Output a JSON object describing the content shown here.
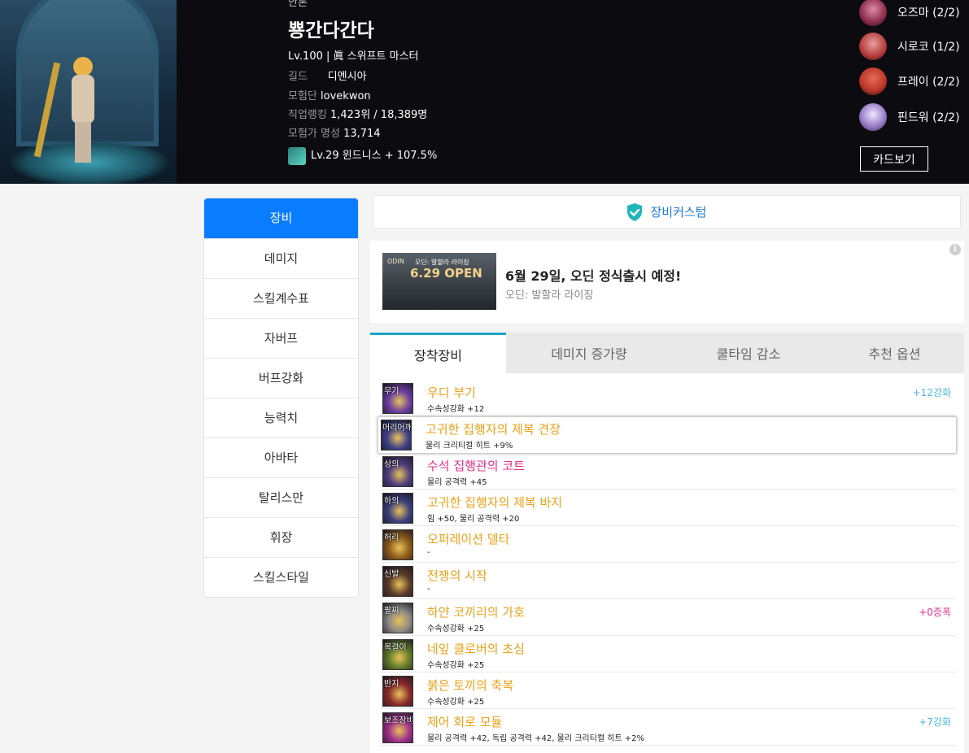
{
  "header": {
    "server": "안톤",
    "character_name": "뿅간다간다",
    "level_class": "Lv.100 | 眞 스위프트 마스터",
    "guild_label": "길드",
    "guild_value": "디멘시아",
    "adventure_label": "모험단",
    "adventure_value": "lovekwon",
    "job_rank_label": "직업랭킹",
    "job_rank_value": "1,423위 / 18,389명",
    "fame_label": "모험가 명성",
    "fame_value": "13,714",
    "gem_text": "Lv.29 윈드니스 + 107.5%"
  },
  "cards": {
    "items": [
      {
        "name": "오즈마 (2/2)",
        "color": "#8a2b4a"
      },
      {
        "name": "시로코 (1/2)",
        "color": "#b33a3a"
      },
      {
        "name": "프레이 (2/2)",
        "color": "#c0392b"
      },
      {
        "name": "핀드워 (2/2)",
        "color": "#9a7fc8"
      }
    ],
    "button_label": "카드보기"
  },
  "sidebar": {
    "items": [
      {
        "label": "장비",
        "active": true
      },
      {
        "label": "데미지"
      },
      {
        "label": "스킬계수표"
      },
      {
        "label": "자버프"
      },
      {
        "label": "버프강화"
      },
      {
        "label": "능력치"
      },
      {
        "label": "아바타"
      },
      {
        "label": "탈리스만"
      },
      {
        "label": "휘장"
      },
      {
        "label": "스킬스타일"
      }
    ]
  },
  "custom_button": {
    "label": "장비커스텀",
    "icon": "shield-check-icon",
    "color": "#1fb6b8"
  },
  "banner": {
    "thumb_brand": "ODIN",
    "thumb_sub": "오딘: 발할라 라이징",
    "thumb_open": "6.29 OPEN",
    "title": "6월 29일, 오딘 정식출시 예정!",
    "subtitle": "오딘: 발할라 라이징",
    "info_icon": "i"
  },
  "tabs": [
    {
      "label": "장착장비",
      "active": true
    },
    {
      "label": "데미지 증가량"
    },
    {
      "label": "쿨타임 감소"
    },
    {
      "label": "추천 옵션"
    }
  ],
  "equipment": [
    {
      "slot": "무기",
      "name": "우디 부기",
      "stat": "수속성강화 +12",
      "right": "+12강화",
      "right_color": "#4ab6e0",
      "name_color": "orange",
      "icon_color": "#6b3fa0"
    },
    {
      "slot": "머리어깨",
      "name": "고귀한 집행자의 제복 견장",
      "stat": "물리 크리티컬 히트 +9%",
      "right": "",
      "name_color": "orange",
      "icon_color": "#3c3f86",
      "selected": true
    },
    {
      "slot": "상의",
      "name": "수석 집행관의 코트",
      "stat": "물리 공격력 +45",
      "right": "",
      "name_color": "pink",
      "icon_color": "#4e3e7e"
    },
    {
      "slot": "하의",
      "name": "고귀한 집행자의 제복 바지",
      "stat": "힘 +50, 물리 공격력 +20",
      "right": "",
      "name_color": "orange",
      "icon_color": "#3b3f7d"
    },
    {
      "slot": "허리",
      "name": "오퍼레이션 델타",
      "stat": "-",
      "right": "",
      "name_color": "orange",
      "icon_color": "#8a5a1a"
    },
    {
      "slot": "신발",
      "name": "전쟁의 시작",
      "stat": "-",
      "right": "",
      "name_color": "orange",
      "icon_color": "#5a3b2a"
    },
    {
      "slot": "팔찌",
      "name": "하얀 코끼리의 가호",
      "stat": "수속성강화 +25",
      "right": "+0증폭",
      "right_color": "#e0308a",
      "name_color": "orange",
      "icon_color": "#8d8a86"
    },
    {
      "slot": "목걸이",
      "name": "네잎 클로버의 초심",
      "stat": "수속성강화 +25",
      "right": "",
      "name_color": "orange",
      "icon_color": "#5e7a2a"
    },
    {
      "slot": "반지",
      "name": "붉은 토끼의 축복",
      "stat": "수속성강화 +25",
      "right": "",
      "name_color": "orange",
      "icon_color": "#8a2a2a"
    },
    {
      "slot": "보조장비",
      "name": "제어 회로 모듈",
      "stat": "물리 공격력 +42, 독립 공격력 +42, 물리 크리티컬 히트 +2%",
      "right": "+7강화",
      "right_color": "#4ab6e0",
      "name_color": "orange",
      "icon_color": "#a0308a"
    }
  ]
}
